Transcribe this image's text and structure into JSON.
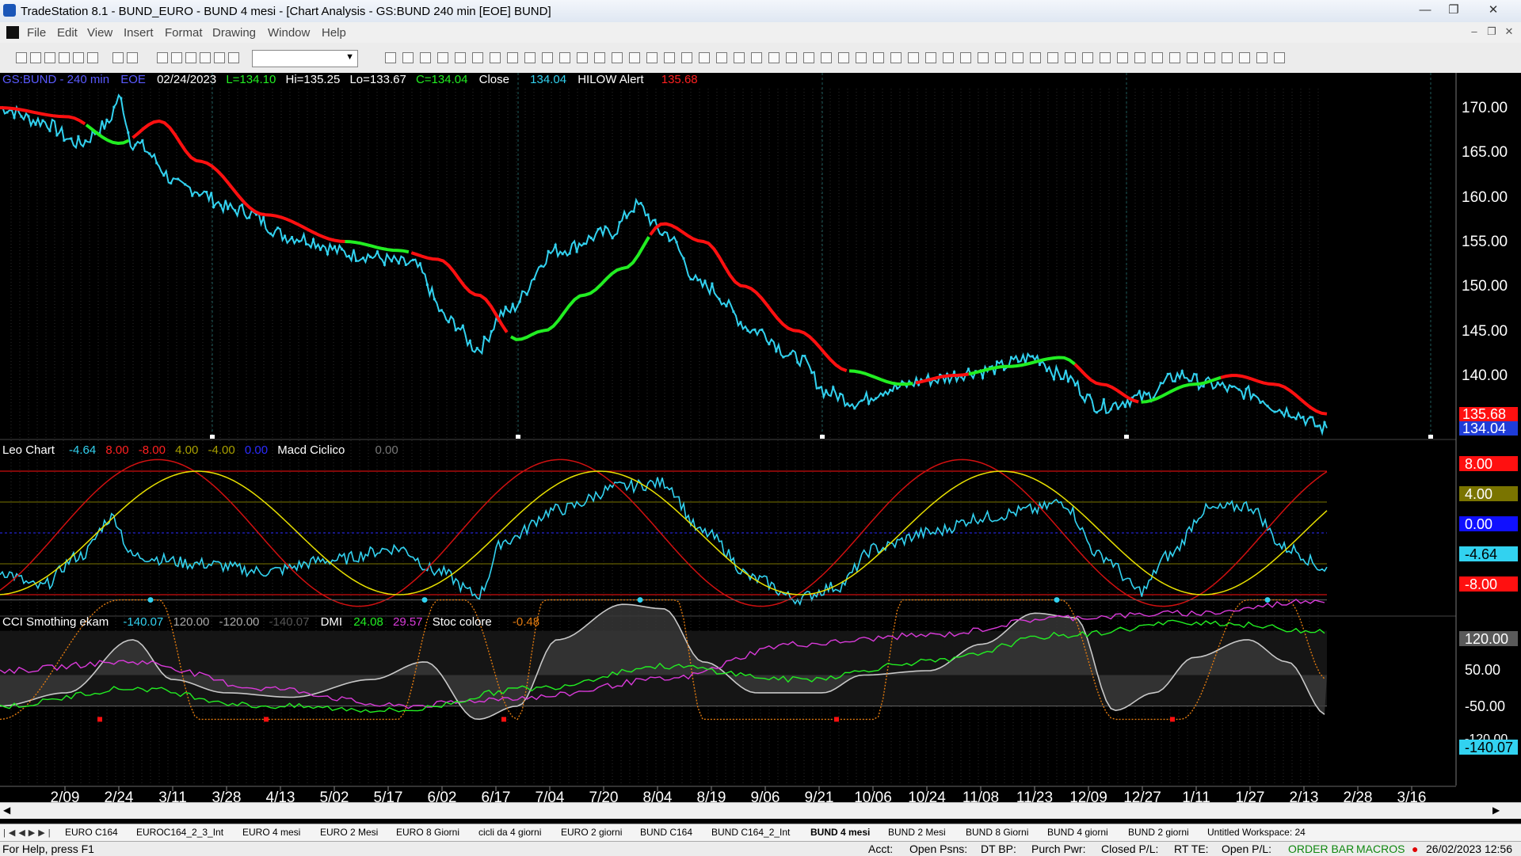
{
  "window": {
    "title": "TradeStation 8.1 - BUND_EURO - BUND 4 mesi - [Chart Analysis - GS:BUND  240 min  [EOE] BUND]"
  },
  "menu": [
    "File",
    "Edit",
    "View",
    "Insert",
    "Format",
    "Drawing",
    "Window",
    "Help"
  ],
  "price_pane": {
    "symbol": "GS:BUND - 240 min",
    "exchange": "EOE",
    "date": "02/24/2023",
    "low": "L=134.10",
    "high": "Hi=135.25",
    "lo": "Lo=133.67",
    "close_eq": "C=134.04",
    "close_label": "Close",
    "close_value": "134.04",
    "alert_label": "HILOW Alert",
    "alert_value": "135.68",
    "axis_labels": [
      "170.00",
      "165.00",
      "160.00",
      "155.00",
      "150.00",
      "145.00",
      "140.00"
    ],
    "last_red": "135.68",
    "last_cyan": "134.04"
  },
  "osc_pane": {
    "name": "Leo Chart",
    "v1": "-4.64",
    "v2": "8.00",
    "v3": "-8.00",
    "v4": "4.00",
    "v5": "-4.00",
    "v6": "0.00",
    "name2": "Macd Ciclico",
    "v7": "0.00",
    "axis_8": "8.00",
    "axis_4": "4.00",
    "axis_0": "0.00",
    "axis_m464": "-4.64",
    "axis_m8": "-8.00"
  },
  "cci_pane": {
    "name": "CCI Smothing ekam",
    "v1": "-140.07",
    "v2": "120.00",
    "v3": "-120.00",
    "v4": "-140.07",
    "dmi_label": "DMI",
    "dmi1": "24.08",
    "dmi2": "29.57",
    "stoc_label": "Stoc colore",
    "stoc": "-0.48",
    "axis_120": "120.00",
    "axis_50": "50.00",
    "axis_m50": "-50.00",
    "axis_m120": "-120.00",
    "axis_last": "-140.07"
  },
  "date_axis": [
    "2/09",
    "2/24",
    "3/11",
    "3/28",
    "4/13",
    "5/02",
    "5/17",
    "6/02",
    "6/17",
    "7/04",
    "7/20",
    "8/04",
    "8/19",
    "9/06",
    "9/21",
    "10/06",
    "10/24",
    "11/08",
    "11/23",
    "12/09",
    "12/27",
    "1/11",
    "1/27",
    "2/13",
    "2/28",
    "3/16"
  ],
  "tabs": [
    "EURO C164",
    "EUROC164_2_3_Int",
    "EURO 4 mesi",
    "EURO 2 Mesi",
    "EURO 8 Giorni",
    "cicli da 4 giorni",
    "EURO 2 giorni",
    "BUND C164",
    "BUND C164_2_Int",
    "BUND 4 mesi",
    "BUND  2 Mesi",
    "BUND 8 Giorni",
    "BUND 4 giorni",
    "BUND 2 giorni",
    "Untitled Workspace:  24"
  ],
  "active_tab": "BUND 4 mesi",
  "status": {
    "help": "For Help, press F1",
    "acct": "Acct:",
    "open_psns": "Open Psns:",
    "dt_bp": "DT BP:",
    "purch_pwr": "Purch Pwr:",
    "closed_pl": "Closed P/L:",
    "rt_te": "RT TE:",
    "open_pl": "Open P/L:",
    "order_bar": "ORDER BAR",
    "macros": "MACROS",
    "datetime": "26/02/2023 12:56"
  },
  "colors": {
    "price": "#32d2f0",
    "red_ma": "#ff1010",
    "green_ma": "#22ee22",
    "yellow": "#e8e000",
    "magenta": "#d93ad9",
    "grey": "#c8c8c8",
    "orange": "#e07a10"
  }
}
